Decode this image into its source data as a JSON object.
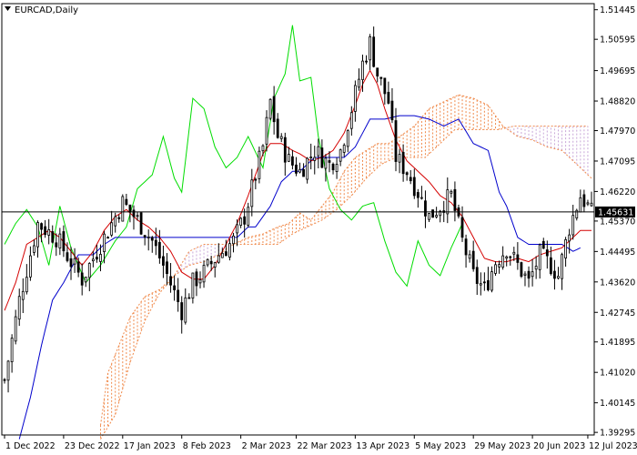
{
  "chart_data": {
    "type": "candlestick",
    "title": "EURCAD,Daily",
    "xlabel": "",
    "ylabel": "",
    "ylim": [
      1.3922,
      1.5162
    ],
    "grid": false,
    "current_price": 1.45631,
    "current_price_label": "1.45631",
    "y_ticks": [
      1.51445,
      1.50595,
      1.49695,
      1.4882,
      1.4797,
      1.47095,
      1.4622,
      1.4537,
      1.44495,
      1.4362,
      1.42745,
      1.41895,
      1.4102,
      1.40145,
      1.39295
    ],
    "y_tick_labels": [
      "1.51445",
      "1.50595",
      "1.49695",
      "1.48820",
      "1.47970",
      "1.47095",
      "1.46220",
      "1.45370",
      "1.44495",
      "1.43620",
      "1.42745",
      "1.41895",
      "1.41020",
      "1.40145",
      "1.39295"
    ],
    "x_labels": [
      {
        "label": "1 Dec 2022",
        "index": 0
      },
      {
        "label": "23 Dec 2022",
        "index": 16
      },
      {
        "label": "17 Jan 2023",
        "index": 32
      },
      {
        "label": "8 Feb 2023",
        "index": 48
      },
      {
        "label": "2 Mar 2023",
        "index": 64
      },
      {
        "label": "22 Mar 2023",
        "index": 79
      },
      {
        "label": "13 Apr 2023",
        "index": 95
      },
      {
        "label": "5 May 2023",
        "index": 111
      },
      {
        "label": "29 May 2023",
        "index": 127
      },
      {
        "label": "20 Jun 2023",
        "index": 143
      },
      {
        "label": "12 Jul 2023",
        "index": 158
      }
    ],
    "close_anchors": [
      [
        0,
        1.408
      ],
      [
        4,
        1.431
      ],
      [
        9,
        1.453
      ],
      [
        14,
        1.449
      ],
      [
        18,
        1.442
      ],
      [
        21,
        1.437
      ],
      [
        24,
        1.443
      ],
      [
        28,
        1.451
      ],
      [
        32,
        1.459
      ],
      [
        36,
        1.454
      ],
      [
        40,
        1.448
      ],
      [
        43,
        1.441
      ],
      [
        46,
        1.433
      ],
      [
        48,
        1.428
      ],
      [
        51,
        1.436
      ],
      [
        54,
        1.439
      ],
      [
        58,
        1.444
      ],
      [
        62,
        1.448
      ],
      [
        65,
        1.455
      ],
      [
        68,
        1.467
      ],
      [
        70,
        1.475
      ],
      [
        72,
        1.488
      ],
      [
        74,
        1.478
      ],
      [
        77,
        1.471
      ],
      [
        80,
        1.468
      ],
      [
        84,
        1.474
      ],
      [
        88,
        1.47
      ],
      [
        91,
        1.474
      ],
      [
        94,
        1.486
      ],
      [
        97,
        1.499
      ],
      [
        99,
        1.505
      ],
      [
        101,
        1.496
      ],
      [
        104,
        1.488
      ],
      [
        106,
        1.472
      ],
      [
        109,
        1.468
      ],
      [
        112,
        1.462
      ],
      [
        115,
        1.455
      ],
      [
        118,
        1.458
      ],
      [
        121,
        1.461
      ],
      [
        124,
        1.448
      ],
      [
        127,
        1.438
      ],
      [
        130,
        1.434
      ],
      [
        133,
        1.442
      ],
      [
        136,
        1.446
      ],
      [
        139,
        1.441
      ],
      [
        142,
        1.436
      ],
      [
        145,
        1.444
      ],
      [
        148,
        1.441
      ],
      [
        150,
        1.438
      ],
      [
        153,
        1.452
      ],
      [
        156,
        1.461
      ],
      [
        158,
        1.458
      ],
      [
        159,
        1.456
      ]
    ],
    "chikou_anchors": [
      [
        0,
        1.447
      ],
      [
        3,
        1.453
      ],
      [
        6,
        1.457
      ],
      [
        9,
        1.452
      ],
      [
        12,
        1.441
      ],
      [
        15,
        1.458
      ],
      [
        18,
        1.446
      ],
      [
        22,
        1.436
      ],
      [
        26,
        1.441
      ],
      [
        30,
        1.448
      ],
      [
        33,
        1.452
      ],
      [
        36,
        1.463
      ],
      [
        40,
        1.467
      ],
      [
        43,
        1.478
      ],
      [
        46,
        1.466
      ],
      [
        48,
        1.462
      ],
      [
        51,
        1.489
      ],
      [
        54,
        1.486
      ],
      [
        57,
        1.475
      ],
      [
        60,
        1.469
      ],
      [
        63,
        1.472
      ],
      [
        66,
        1.478
      ],
      [
        70,
        1.469
      ],
      [
        73,
        1.489
      ],
      [
        76,
        1.496
      ],
      [
        78,
        1.51
      ],
      [
        80,
        1.494
      ],
      [
        83,
        1.495
      ],
      [
        85,
        1.478
      ],
      [
        88,
        1.463
      ],
      [
        91,
        1.457
      ],
      [
        94,
        1.454
      ],
      [
        97,
        1.458
      ],
      [
        100,
        1.459
      ],
      [
        103,
        1.448
      ],
      [
        106,
        1.439
      ],
      [
        109,
        1.435
      ],
      [
        112,
        1.448
      ],
      [
        115,
        1.441
      ],
      [
        118,
        1.438
      ],
      [
        121,
        1.446
      ],
      [
        124,
        1.453
      ]
    ],
    "kijun_anchors": [
      [
        4,
        1.391
      ],
      [
        7,
        1.403
      ],
      [
        10,
        1.418
      ],
      [
        13,
        1.431
      ],
      [
        16,
        1.436
      ],
      [
        20,
        1.444
      ],
      [
        24,
        1.444
      ],
      [
        27,
        1.447
      ],
      [
        30,
        1.449
      ],
      [
        33,
        1.449
      ],
      [
        36,
        1.449
      ],
      [
        42,
        1.449
      ],
      [
        46,
        1.449
      ],
      [
        50,
        1.449
      ],
      [
        56,
        1.449
      ],
      [
        60,
        1.449
      ],
      [
        63,
        1.449
      ],
      [
        66,
        1.452
      ],
      [
        68,
        1.452
      ],
      [
        72,
        1.458
      ],
      [
        75,
        1.465
      ],
      [
        78,
        1.468
      ],
      [
        80,
        1.468
      ],
      [
        84,
        1.472
      ],
      [
        88,
        1.472
      ],
      [
        92,
        1.472
      ],
      [
        95,
        1.475
      ],
      [
        99,
        1.483
      ],
      [
        103,
        1.483
      ],
      [
        107,
        1.484
      ],
      [
        111,
        1.484
      ],
      [
        115,
        1.483
      ],
      [
        119,
        1.481
      ],
      [
        123,
        1.483
      ],
      [
        127,
        1.476
      ],
      [
        131,
        1.474
      ],
      [
        134,
        1.462
      ],
      [
        136,
        1.458
      ],
      [
        139,
        1.449
      ],
      [
        142,
        1.447
      ],
      [
        145,
        1.447
      ],
      [
        148,
        1.447
      ],
      [
        151,
        1.447
      ],
      [
        154,
        1.445
      ],
      [
        156,
        1.446
      ]
    ],
    "tenkan_anchors": [
      [
        0,
        1.428
      ],
      [
        3,
        1.436
      ],
      [
        6,
        1.447
      ],
      [
        9,
        1.449
      ],
      [
        12,
        1.451
      ],
      [
        15,
        1.449
      ],
      [
        18,
        1.445
      ],
      [
        21,
        1.441
      ],
      [
        24,
        1.445
      ],
      [
        27,
        1.451
      ],
      [
        30,
        1.455
      ],
      [
        33,
        1.457
      ],
      [
        36,
        1.454
      ],
      [
        39,
        1.452
      ],
      [
        42,
        1.449
      ],
      [
        45,
        1.445
      ],
      [
        48,
        1.439
      ],
      [
        51,
        1.437
      ],
      [
        54,
        1.437
      ],
      [
        57,
        1.441
      ],
      [
        60,
        1.447
      ],
      [
        63,
        1.453
      ],
      [
        66,
        1.461
      ],
      [
        68,
        1.467
      ],
      [
        70,
        1.473
      ],
      [
        72,
        1.476
      ],
      [
        75,
        1.476
      ],
      [
        78,
        1.474
      ],
      [
        80,
        1.473
      ],
      [
        83,
        1.471
      ],
      [
        86,
        1.472
      ],
      [
        89,
        1.474
      ],
      [
        92,
        1.479
      ],
      [
        95,
        1.487
      ],
      [
        97,
        1.493
      ],
      [
        99,
        1.497
      ],
      [
        101,
        1.493
      ],
      [
        103,
        1.486
      ],
      [
        106,
        1.477
      ],
      [
        109,
        1.471
      ],
      [
        112,
        1.468
      ],
      [
        115,
        1.465
      ],
      [
        118,
        1.461
      ],
      [
        121,
        1.459
      ],
      [
        124,
        1.455
      ],
      [
        127,
        1.449
      ],
      [
        130,
        1.443
      ],
      [
        133,
        1.442
      ],
      [
        136,
        1.442
      ],
      [
        139,
        1.443
      ],
      [
        142,
        1.442
      ],
      [
        145,
        1.444
      ],
      [
        148,
        1.445
      ],
      [
        151,
        1.446
      ],
      [
        154,
        1.449
      ],
      [
        156,
        1.451
      ],
      [
        159,
        1.451
      ]
    ],
    "span_a_anchors": [
      [
        26,
        1.395
      ],
      [
        28,
        1.41
      ],
      [
        31,
        1.418
      ],
      [
        34,
        1.426
      ],
      [
        38,
        1.432
      ],
      [
        42,
        1.434
      ],
      [
        46,
        1.438
      ],
      [
        50,
        1.441
      ],
      [
        54,
        1.442
      ],
      [
        58,
        1.444
      ],
      [
        62,
        1.447
      ],
      [
        66,
        1.449
      ],
      [
        70,
        1.45
      ],
      [
        74,
        1.452
      ],
      [
        77,
        1.453
      ],
      [
        80,
        1.456
      ],
      [
        83,
        1.454
      ],
      [
        86,
        1.458
      ],
      [
        89,
        1.462
      ],
      [
        92,
        1.468
      ],
      [
        95,
        1.472
      ],
      [
        98,
        1.474
      ],
      [
        101,
        1.476
      ],
      [
        104,
        1.476
      ],
      [
        107,
        1.478
      ],
      [
        111,
        1.481
      ],
      [
        115,
        1.486
      ],
      [
        119,
        1.488
      ],
      [
        123,
        1.49
      ],
      [
        127,
        1.489
      ],
      [
        131,
        1.487
      ],
      [
        135,
        1.481
      ],
      [
        139,
        1.478
      ],
      [
        143,
        1.477
      ],
      [
        147,
        1.475
      ],
      [
        151,
        1.474
      ],
      [
        155,
        1.47
      ],
      [
        159,
        1.466
      ]
    ],
    "span_b_anchors": [
      [
        26,
        1.391
      ],
      [
        30,
        1.398
      ],
      [
        34,
        1.413
      ],
      [
        38,
        1.425
      ],
      [
        42,
        1.433
      ],
      [
        46,
        1.438
      ],
      [
        50,
        1.445
      ],
      [
        54,
        1.447
      ],
      [
        58,
        1.447
      ],
      [
        62,
        1.447
      ],
      [
        66,
        1.447
      ],
      [
        70,
        1.447
      ],
      [
        74,
        1.447
      ],
      [
        78,
        1.45
      ],
      [
        82,
        1.452
      ],
      [
        86,
        1.454
      ],
      [
        90,
        1.457
      ],
      [
        94,
        1.461
      ],
      [
        98,
        1.466
      ],
      [
        102,
        1.47
      ],
      [
        106,
        1.472
      ],
      [
        110,
        1.472
      ],
      [
        114,
        1.472
      ],
      [
        118,
        1.476
      ],
      [
        122,
        1.48
      ],
      [
        126,
        1.48
      ],
      [
        130,
        1.48
      ],
      [
        134,
        1.48
      ],
      [
        138,
        1.481
      ],
      [
        142,
        1.481
      ],
      [
        146,
        1.481
      ],
      [
        150,
        1.481
      ],
      [
        154,
        1.481
      ],
      [
        158,
        1.481
      ]
    ],
    "colors": {
      "bull_candle": "#000000",
      "bear_candle": "#000000",
      "tenkan": "#d40000",
      "kijun": "#0000cc",
      "chikou": "#00dd00",
      "cloud_bull": "#f08a4b",
      "cloud_bear": "#c8a6d8",
      "price_line": "#000000"
    },
    "bars": 160
  }
}
